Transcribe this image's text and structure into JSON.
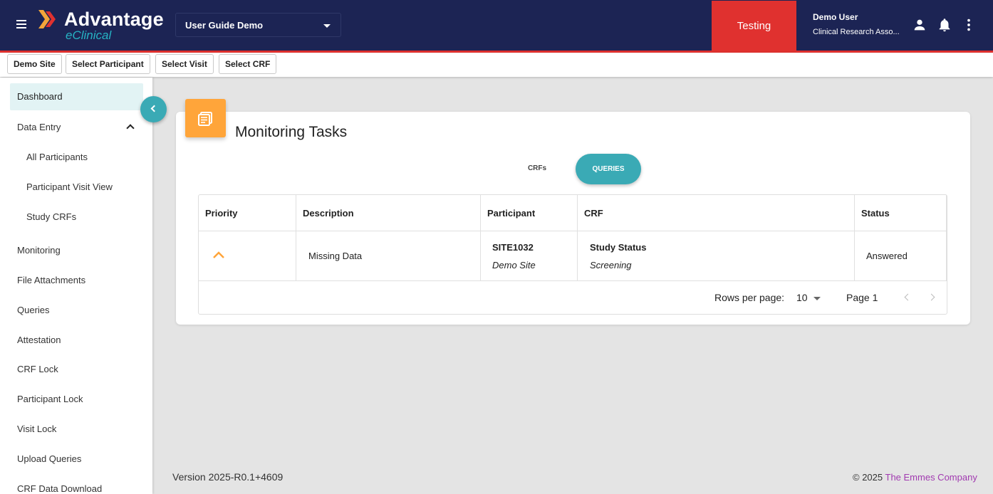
{
  "header": {
    "app_name": "Advantage",
    "app_sub": "eClinical",
    "study": "User Guide Demo",
    "environment": "Testing",
    "user_name": "Demo User",
    "user_role": "Clinical Research Asso...",
    "icons": [
      "menu-icon",
      "person-icon",
      "bell-icon",
      "more-vert-icon"
    ],
    "colors": {
      "navy": "#1c2454",
      "red": "#e0312f",
      "teal": "#3aaab5",
      "orange": "#ffa53a"
    }
  },
  "breadcrumbs": [
    "Demo Site",
    "Select Participant",
    "Select Visit",
    "Select CRF"
  ],
  "sidebar": {
    "items": [
      {
        "label": "Dashboard"
      },
      {
        "label": "Data Entry"
      },
      {
        "label": "All Participants"
      },
      {
        "label": "Participant Visit View"
      },
      {
        "label": "Study CRFs"
      },
      {
        "label": "Monitoring"
      },
      {
        "label": "File Attachments"
      },
      {
        "label": "Queries"
      },
      {
        "label": "Attestation"
      },
      {
        "label": "CRF Lock"
      },
      {
        "label": "Participant Lock"
      },
      {
        "label": "Visit Lock"
      },
      {
        "label": "Upload Queries"
      },
      {
        "label": "CRF Data Download"
      }
    ]
  },
  "main": {
    "title": "Monitoring Tasks",
    "tabs": [
      {
        "label": "CRFs"
      },
      {
        "label": "QUERIES"
      }
    ],
    "columns": [
      "Priority",
      "Description",
      "Participant",
      "CRF",
      "Status"
    ],
    "rows": [
      {
        "priority_icon": "chevron-up-icon",
        "description": "Missing Data",
        "participant": "SITE1032",
        "site": "Demo Site",
        "crf": "Study Status",
        "visit": "Screening",
        "status": "Answered"
      }
    ],
    "pager": {
      "rows_label": "Rows per page:",
      "rows_value": "10",
      "page_label": "Page 1"
    }
  },
  "footer": {
    "version": "Version 2025-R0.1+4609",
    "copyright": "© 2025 ",
    "company": "The Emmes Company"
  }
}
